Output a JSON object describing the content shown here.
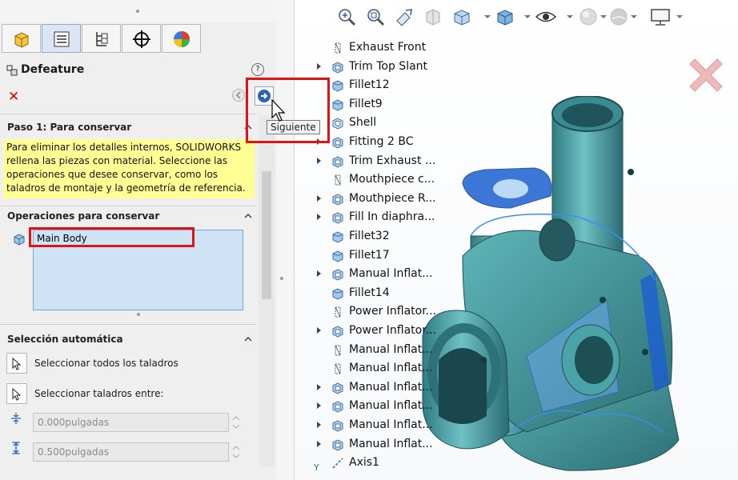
{
  "property_manager": {
    "title": "Defeature",
    "help_label": "?",
    "tabs": [
      "feature-manager",
      "property-manager",
      "configuration-manager",
      "dimxpert-manager",
      "display-manager"
    ],
    "tooltip_next": "Siguiente",
    "step_section": {
      "title": "Paso 1: Para conservar",
      "message": "Para eliminar los detalles internos, SOLIDWORKS rellena las piezas con material. Seleccione las operaciones que desee conservar, como los taladros de montaje y la geometría de referencia."
    },
    "keep_section": {
      "title": "Operaciones para conservar",
      "items": [
        "Main Body"
      ]
    },
    "auto_section": {
      "title": "Selección automática",
      "select_all_holes": "Seleccionar todos los taladros",
      "select_holes_between": "Seleccionar taladros entre:",
      "min_value": "0.000pulgadas",
      "max_value": "0.500pulgadas"
    }
  },
  "feature_tree": [
    {
      "label": "Exhaust Front",
      "expandable": false,
      "icon": "sketch-icon"
    },
    {
      "label": "Trim Top Slant",
      "expandable": true,
      "icon": "feature-icon"
    },
    {
      "label": "Fillet12",
      "expandable": false,
      "icon": "fillet-icon"
    },
    {
      "label": "Fillet9",
      "expandable": false,
      "icon": "fillet-icon"
    },
    {
      "label": "Shell",
      "expandable": false,
      "icon": "shell-icon"
    },
    {
      "label": "Fitting 2 BC",
      "expandable": true,
      "icon": "feature-icon"
    },
    {
      "label": "Trim Exhaust ...",
      "expandable": true,
      "icon": "feature-icon"
    },
    {
      "label": "Mouthpiece c...",
      "expandable": false,
      "icon": "sketch-icon"
    },
    {
      "label": "Mouthpiece R...",
      "expandable": true,
      "icon": "feature-icon"
    },
    {
      "label": "Fill In diaphra...",
      "expandable": true,
      "icon": "feature-icon"
    },
    {
      "label": "Fillet32",
      "expandable": false,
      "icon": "fillet-icon"
    },
    {
      "label": "Fillet17",
      "expandable": false,
      "icon": "fillet-icon"
    },
    {
      "label": "Manual Inflat...",
      "expandable": true,
      "icon": "feature-icon"
    },
    {
      "label": "Fillet14",
      "expandable": false,
      "icon": "fillet-icon"
    },
    {
      "label": "Power Inflator...",
      "expandable": false,
      "icon": "sketch-icon"
    },
    {
      "label": "Power Inflator...",
      "expandable": true,
      "icon": "feature-icon"
    },
    {
      "label": "Manual Inflat...",
      "expandable": false,
      "icon": "sketch-icon"
    },
    {
      "label": "Manual Inflat...",
      "expandable": false,
      "icon": "sketch-icon"
    },
    {
      "label": "Manual Inflat...",
      "expandable": true,
      "icon": "feature-icon"
    },
    {
      "label": "Manual Inflat...",
      "expandable": true,
      "icon": "feature-icon"
    },
    {
      "label": "Manual Inflat...",
      "expandable": true,
      "icon": "feature-icon"
    },
    {
      "label": "Manual Inflat...",
      "expandable": true,
      "icon": "feature-icon"
    },
    {
      "label": "Axis1",
      "expandable": false,
      "icon": "axis-icon"
    }
  ],
  "heads_up_toolbar": [
    "zoom-to-fit-icon",
    "zoom-to-area-icon",
    "previous-view-icon",
    "section-view-icon",
    "view-orientation-icon",
    "display-style-icon",
    "hide-show-icon",
    "edit-appearance-icon",
    "apply-scene-icon",
    "view-settings-icon"
  ],
  "axis_label": "Y",
  "colors": {
    "highlight": "#e21212",
    "part_fill": "#4fa8a8",
    "selection_blue": "#1b5fd1",
    "tooltip_bg": "#f2f2f2"
  }
}
